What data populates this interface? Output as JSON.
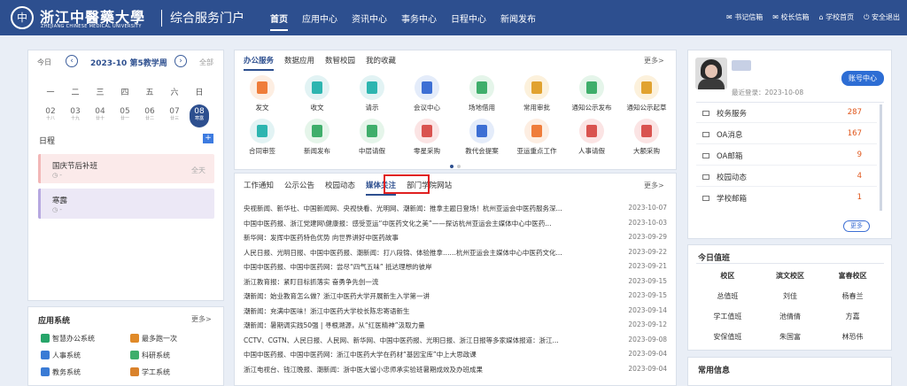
{
  "header": {
    "logo_glyph": "中",
    "school": "浙江中醫藥大學",
    "school_en": "ZHEJIANG CHINESE MEDICAL UNIVERSITY",
    "portal": "综合服务门户",
    "nav": [
      "首页",
      "应用中心",
      "资讯中心",
      "事务中心",
      "日程中心",
      "新闻发布"
    ],
    "right": [
      "书记信箱",
      "校长信箱",
      "学校首页",
      "安全退出"
    ]
  },
  "calendar": {
    "today": "今日",
    "week_title": "2023-10 第5教学周",
    "all": "全部",
    "prev": "‹",
    "next": "›",
    "weekdays": [
      "一",
      "二",
      "三",
      "四",
      "五",
      "六",
      "日"
    ],
    "days": [
      {
        "n": "02",
        "l": "十八"
      },
      {
        "n": "03",
        "l": "十九"
      },
      {
        "n": "04",
        "l": "廿十"
      },
      {
        "n": "05",
        "l": "廿一"
      },
      {
        "n": "06",
        "l": "廿二"
      },
      {
        "n": "07",
        "l": "廿三"
      },
      {
        "n": "08",
        "l": "寒露"
      }
    ],
    "schedule_label": "日程",
    "add": "+",
    "events": [
      {
        "title": "国庆节后补班",
        "date": "-",
        "allday": "全天"
      },
      {
        "title": "寒露",
        "date": "-",
        "allday": ""
      }
    ]
  },
  "apps": {
    "title": "应用系统",
    "more": "更多>",
    "items": [
      {
        "label": "智慧办公系统",
        "color": "#27a56a"
      },
      {
        "label": "最多跑一次",
        "color": "#e08a28"
      },
      {
        "label": "人事系统",
        "color": "#3a7bd5"
      },
      {
        "label": "科研系统",
        "color": "#3fae6b"
      },
      {
        "label": "教务系统",
        "color": "#3a7bd5"
      },
      {
        "label": "学工系统",
        "color": "#d9822b"
      }
    ]
  },
  "office": {
    "tabs": [
      "办公服务",
      "数据应用",
      "数智校园",
      "我的收藏"
    ],
    "more": "更多>",
    "services": [
      {
        "label": "发文",
        "bg": "#fdeee2",
        "fg": "#ef7d3a"
      },
      {
        "label": "收文",
        "bg": "#e2f3f4",
        "fg": "#2db5b0"
      },
      {
        "label": "请示",
        "bg": "#e2f3f4",
        "fg": "#2db5b0"
      },
      {
        "label": "会议中心",
        "bg": "#e4ecfa",
        "fg": "#3d6fd4"
      },
      {
        "label": "场地借用",
        "bg": "#e5f5ea",
        "fg": "#3fae6b"
      },
      {
        "label": "常用审批",
        "bg": "#fcf1dc",
        "fg": "#e1a230"
      },
      {
        "label": "通知公示发布",
        "bg": "#e5f5ea",
        "fg": "#3fae6b"
      },
      {
        "label": "通知公示起草",
        "bg": "#fcf1dc",
        "fg": "#e1a230"
      },
      {
        "label": "合同审签",
        "bg": "#e2f3f4",
        "fg": "#2db5b0"
      },
      {
        "label": "新闻发布",
        "bg": "#e5f5ea",
        "fg": "#3fae6b"
      },
      {
        "label": "中层请假",
        "bg": "#e5f5ea",
        "fg": "#3fae6b"
      },
      {
        "label": "零星采购",
        "bg": "#fbe4e4",
        "fg": "#d9534f"
      },
      {
        "label": "教代会提案",
        "bg": "#e4ecfa",
        "fg": "#3d6fd4"
      },
      {
        "label": "亚运重点工作",
        "bg": "#fdeee2",
        "fg": "#ef7d3a"
      },
      {
        "label": "人事请假",
        "bg": "#fbe4e4",
        "fg": "#d9534f"
      },
      {
        "label": "大额采购",
        "bg": "#fbe4e4",
        "fg": "#d9534f"
      }
    ]
  },
  "newsbox": {
    "tabs": [
      "工作通知",
      "公示公告",
      "校园动态",
      "媒体关注",
      "部门学院网站"
    ],
    "more": "更多>",
    "items": [
      {
        "t": "央视新闻、新华社、中国新闻网、央视快看、光明网、潮新闻：推拿主题日登场！杭州亚运会中医药服务深...",
        "d": "2023-10-07"
      },
      {
        "t": "中国中医药报、浙江党建网\\健康报：感受亚运“中医药文化之美”——探访杭州亚运会主媒体中心中医药...",
        "d": "2023-10-03"
      },
      {
        "t": "新华网：发挥中医药特色优势 向世界讲好中医药故事",
        "d": "2023-09-29"
      },
      {
        "t": "人民日报、光明日报、中国中医药报、潮新闻：打八段锦、体验推拿……杭州亚运会主媒体中心中医药文化...",
        "d": "2023-09-22"
      },
      {
        "t": "中国中医药报、中国中医药网：尝尽“四气五味” 抵达理想的彼岸",
        "d": "2023-09-21"
      },
      {
        "t": "浙江教育报：紧盯目标抓落实 奋勇争先创一流",
        "d": "2023-09-15"
      },
      {
        "t": "潮新闻：始业教育怎么做？浙江中医药大学开展新生入学第一讲",
        "d": "2023-09-15"
      },
      {
        "t": "潮新闻：充满中医味！浙江中医药大学校长陈忠寄语新生",
        "d": "2023-09-14"
      },
      {
        "t": "潮新闻：暑期调实践50强 | 寻根溯源，从“红医精神”汲取力量",
        "d": "2023-09-12"
      },
      {
        "t": "CCTV、CGTN、人民日报、人民网、新华网、中国中医药报、光明日报、浙江日报等多家媒体报道：浙江...",
        "d": "2023-09-08"
      },
      {
        "t": "中国中医药报、中国中医药网：浙江中医药大学在药材“基因宝库”中上大思政课",
        "d": "2023-09-04"
      },
      {
        "t": "浙江电视台、钱江晚报、潮新闻：浙中医大留小忠师承实验班暑期成效及办班成果",
        "d": "2023-09-04"
      }
    ]
  },
  "profile": {
    "last_login": "最近登录：2023-10-08",
    "account_btn": "账号中心",
    "messages": [
      {
        "label": "校务服务",
        "count": "287"
      },
      {
        "label": "OA消息",
        "count": "167"
      },
      {
        "label": "OA邮箱",
        "count": "9"
      },
      {
        "label": "校园动态",
        "count": "4"
      },
      {
        "label": "学校邮箱",
        "count": "1"
      }
    ],
    "more": "更多"
  },
  "duty": {
    "title": "今日值班",
    "headers": [
      "校区",
      "滨文校区",
      "富春校区"
    ],
    "rows": [
      [
        "总值班",
        "刘佳",
        "杨春兰"
      ],
      [
        "学工值班",
        "池倩倩",
        "方嘉"
      ],
      [
        "安保值班",
        "朱国富",
        "林恐伟"
      ]
    ]
  },
  "common": {
    "title": "常用信息"
  }
}
